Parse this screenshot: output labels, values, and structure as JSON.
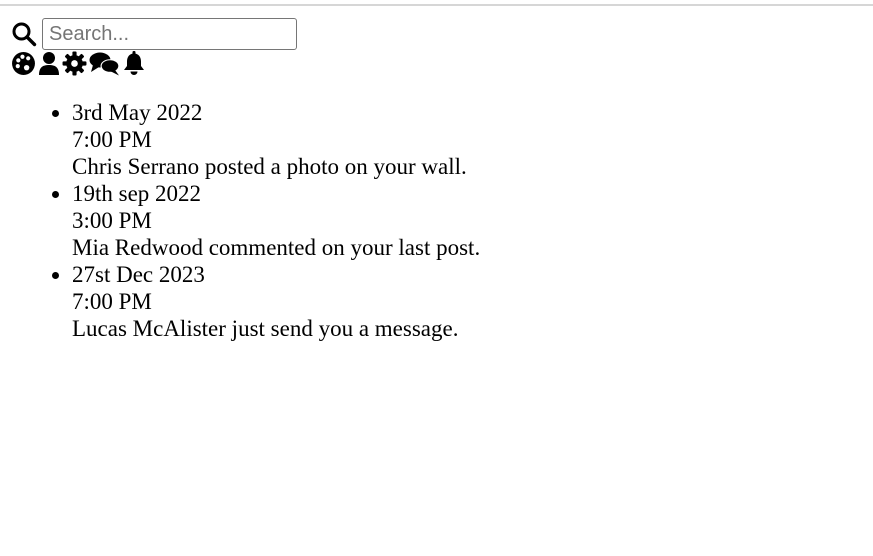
{
  "search": {
    "placeholder": "Search...",
    "value": "",
    "icon": "search-icon"
  },
  "toolbar_icons": [
    {
      "name": "palette-icon"
    },
    {
      "name": "user-icon"
    },
    {
      "name": "gear-icon"
    },
    {
      "name": "comments-icon"
    },
    {
      "name": "bell-icon"
    }
  ],
  "notifications": [
    {
      "date": "3rd May 2022",
      "time": "7:00 PM",
      "message": "Chris Serrano posted a photo on your wall."
    },
    {
      "date": "19th sep 2022",
      "time": "3:00 PM",
      "message": "Mia Redwood commented on your last post."
    },
    {
      "date": "27st Dec 2023",
      "time": "7:00 PM",
      "message": "Lucas McAlister just send you a message."
    }
  ]
}
